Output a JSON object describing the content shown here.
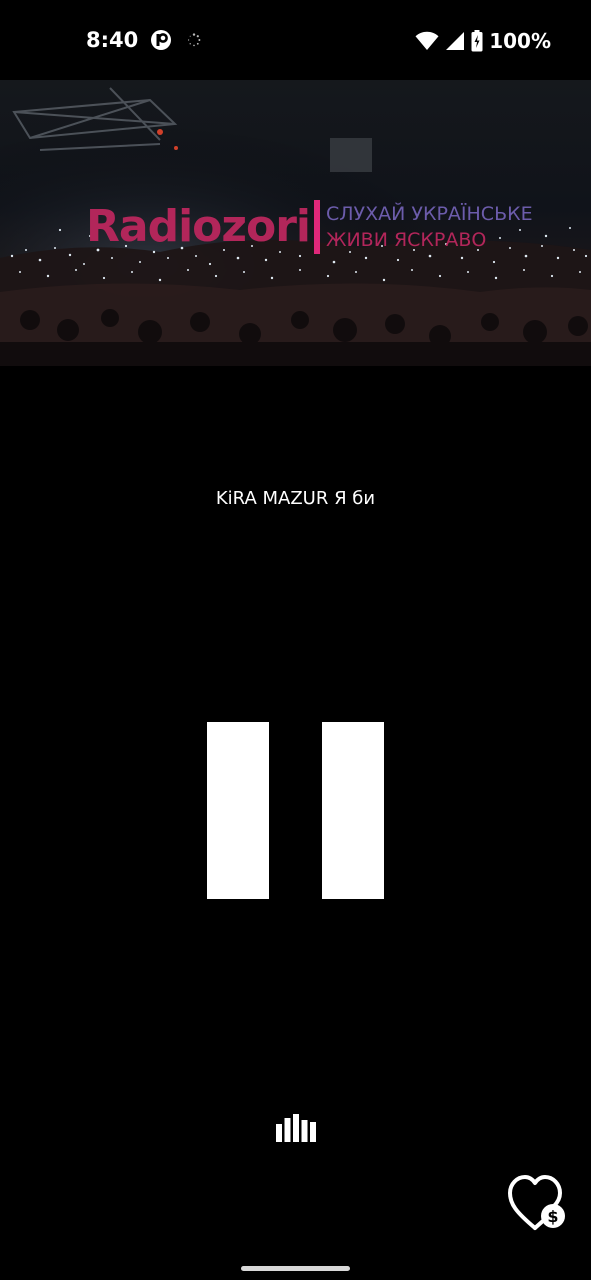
{
  "status_bar": {
    "time": "8:40",
    "battery": "100%",
    "icons": [
      "notification-app-icon",
      "loading-icon",
      "wifi-icon",
      "signal-icon",
      "battery-icon"
    ]
  },
  "banner": {
    "brand": "Radiozori",
    "tagline_line1": "СЛУХАЙ УКРАЇНСЬКЕ",
    "tagline_line2": "ЖИВИ ЯСКРАВО",
    "colors": {
      "brand": "#b2265a",
      "divider": "#e0287a",
      "tagline1": "#6c5cab"
    },
    "background": "concert-crowd-photo"
  },
  "player": {
    "now_playing": "KiRA MAZUR Я би",
    "state": "playing",
    "control_icon": "pause-icon"
  },
  "bottom": {
    "equalizer_icon": "equalizer-icon",
    "donate_icon": "heart-dollar-icon"
  }
}
